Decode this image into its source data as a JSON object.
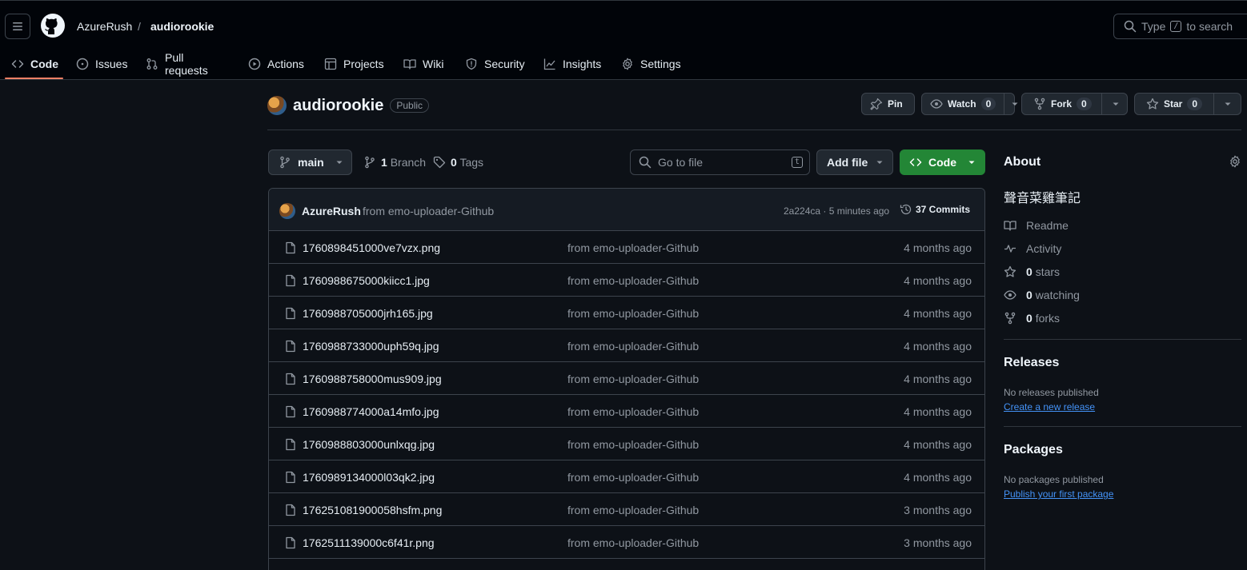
{
  "header": {
    "owner": "AzureRush",
    "separator": "/",
    "repo": "audiorookie",
    "search_text_before": "Type",
    "search_key": "/",
    "search_text_after": "to search"
  },
  "nav": {
    "tabs": [
      {
        "label": "Code",
        "icon": "code-icon",
        "active": true
      },
      {
        "label": "Issues",
        "icon": "issue-icon"
      },
      {
        "label": "Pull requests",
        "icon": "pull-request-icon"
      },
      {
        "label": "Actions",
        "icon": "play-icon"
      },
      {
        "label": "Projects",
        "icon": "table-icon"
      },
      {
        "label": "Wiki",
        "icon": "book-icon"
      },
      {
        "label": "Security",
        "icon": "shield-icon"
      },
      {
        "label": "Insights",
        "icon": "graph-icon"
      },
      {
        "label": "Settings",
        "icon": "gear-icon"
      }
    ]
  },
  "repo_head": {
    "name": "audiorookie",
    "visibility": "Public",
    "pin_label": "Pin",
    "watch_label": "Watch",
    "watch_count": "0",
    "fork_label": "Fork",
    "fork_count": "0",
    "star_label": "Star",
    "star_count": "0"
  },
  "toolbar": {
    "branch": "main",
    "branch_count": "1",
    "branch_label": "Branch",
    "tag_count": "0",
    "tag_label": "Tags",
    "goto_placeholder": "Go to file",
    "goto_key": "t",
    "add_file_label": "Add file",
    "code_label": "Code"
  },
  "commit": {
    "author": "AzureRush",
    "message": "from emo-uploader-Github",
    "hash_time": "2a224ca · 5 minutes ago",
    "commits_count": "37 Commits"
  },
  "files": [
    {
      "name": "1760898451000ve7vzx.png",
      "message": "from emo-uploader-Github",
      "time": "4 months ago"
    },
    {
      "name": "1760988675000kiicc1.jpg",
      "message": "from emo-uploader-Github",
      "time": "4 months ago"
    },
    {
      "name": "1760988705000jrh165.jpg",
      "message": "from emo-uploader-Github",
      "time": "4 months ago"
    },
    {
      "name": "1760988733000uph59q.jpg",
      "message": "from emo-uploader-Github",
      "time": "4 months ago"
    },
    {
      "name": "1760988758000mus909.jpg",
      "message": "from emo-uploader-Github",
      "time": "4 months ago"
    },
    {
      "name": "1760988774000a14mfo.jpg",
      "message": "from emo-uploader-Github",
      "time": "4 months ago"
    },
    {
      "name": "1760988803000unlxqg.jpg",
      "message": "from emo-uploader-Github",
      "time": "4 months ago"
    },
    {
      "name": "1760989134000l03qk2.jpg",
      "message": "from emo-uploader-Github",
      "time": "4 months ago"
    },
    {
      "name": "176251081900058hsfm.png",
      "message": "from emo-uploader-Github",
      "time": "3 months ago"
    },
    {
      "name": "1762511139000c6f41r.png",
      "message": "from emo-uploader-Github",
      "time": "3 months ago"
    }
  ],
  "about": {
    "title": "About",
    "description": "聲音菜雞筆記",
    "readme": "Readme",
    "activity": "Activity",
    "stars_count": "0",
    "stars_label": "stars",
    "watching_count": "0",
    "watching_label": "watching",
    "forks_count": "0",
    "forks_label": "forks"
  },
  "releases": {
    "title": "Releases",
    "empty": "No releases published",
    "link": "Create a new release"
  },
  "packages": {
    "title": "Packages",
    "empty": "No packages published",
    "link": "Publish your first package"
  },
  "colors": {
    "background": "#0d1117",
    "header": "#010409",
    "accent_tab": "#f78166",
    "code_button": "#238636",
    "link": "#4493f8"
  }
}
